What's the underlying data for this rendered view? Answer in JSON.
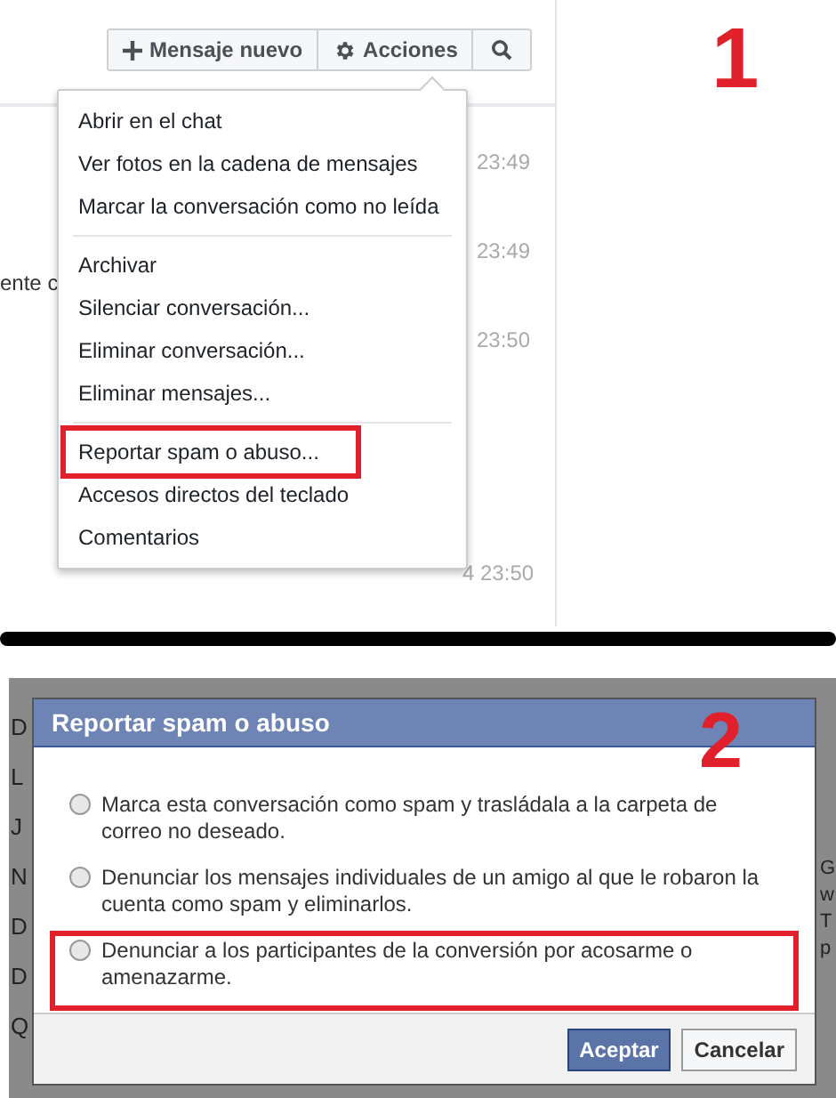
{
  "toolbar": {
    "buttons": [
      {
        "kind": "new",
        "label": "Mensaje nuevo"
      },
      {
        "kind": "actions",
        "label": "Acciones"
      },
      {
        "kind": "search"
      }
    ]
  },
  "menu": {
    "groups": [
      [
        {
          "label": "Abrir en el chat",
          "highlighted": false
        },
        {
          "label": "Ver fotos en la cadena de mensajes",
          "highlighted": false
        },
        {
          "label": "Marcar la conversación como no leída",
          "highlighted": false
        }
      ],
      [
        {
          "label": "Archivar",
          "highlighted": false
        },
        {
          "label": "Silenciar conversación...",
          "highlighted": false
        },
        {
          "label": "Eliminar conversación...",
          "highlighted": false
        },
        {
          "label": "Eliminar mensajes...",
          "highlighted": false
        }
      ],
      [
        {
          "label": "Reportar spam o abuso...",
          "highlighted": true
        },
        {
          "label": "Accesos directos del teclado",
          "highlighted": false
        },
        {
          "label": "Comentarios",
          "highlighted": false
        }
      ]
    ]
  },
  "thread_times": [
    "23:49",
    "23:49",
    "23:50",
    "4 23:50"
  ],
  "thread_snippet": "ente c",
  "annotations": [
    "1",
    "2"
  ],
  "background_list": {
    "left": [
      "D",
      "L",
      "J",
      "N",
      "D",
      "D",
      "Q"
    ],
    "right": [
      "G",
      "w",
      "T",
      "p"
    ]
  },
  "dialog": {
    "title": "Reportar spam o abuso",
    "options": [
      {
        "label": "Marca esta conversación como spam y trasládala a la carpeta de correo no deseado.",
        "selected": false,
        "highlighted": false
      },
      {
        "label": "Denunciar los mensajes individuales de un amigo al que le robaron la cuenta como spam y eliminarlos.",
        "selected": false,
        "highlighted": false
      },
      {
        "label": "Denunciar a los participantes de la conversión por acosarme o amenazarme.",
        "selected": false,
        "highlighted": true
      }
    ],
    "buttons": [
      {
        "kind": "primary",
        "label": "Aceptar"
      },
      {
        "kind": "secondary",
        "label": "Cancelar"
      }
    ]
  }
}
